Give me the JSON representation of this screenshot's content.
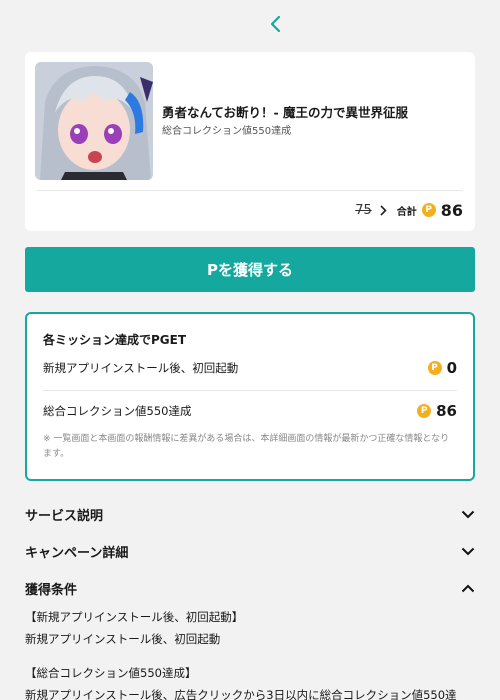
{
  "header": {
    "back_icon": "chevron-left-icon"
  },
  "product": {
    "title": "勇者なんてお断り！- 魔王の力で異世界征服",
    "subtitle": "総合コレクション値550達成",
    "old_price": "75",
    "total_label": "合計",
    "total_value": "86",
    "coin_symbol": "P"
  },
  "cta": {
    "label": "Pを獲得する"
  },
  "missions": {
    "title": "各ミッション達成でPGET",
    "items": [
      {
        "label": "新規アプリインストール後、初回起動",
        "value": "0"
      },
      {
        "label": "総合コレクション値550達成",
        "value": "86"
      }
    ],
    "note": "※ 一覧画面と本画面の報酬情報に差異がある場合は、本詳細画面の情報が最新かつ正確な情報となります。"
  },
  "sections": {
    "service": {
      "label": "サービス説明",
      "state": "collapsed"
    },
    "campaign": {
      "label": "キャンペーン詳細",
      "state": "collapsed"
    },
    "conditions": {
      "label": "獲得条件",
      "state": "expanded"
    }
  },
  "conditions_body": {
    "heading1": "【新規アプリインストール後、初回起動】",
    "text1": "新規アプリインストール後、初回起動",
    "heading2": "【総合コレクション値550達成】",
    "text2": "新規アプリインストール後、広告クリックから3日以内に総合コレクション値550達"
  },
  "colors": {
    "accent": "#14a89e",
    "coin": "#f2b01e",
    "background": "#f2f2f2"
  }
}
